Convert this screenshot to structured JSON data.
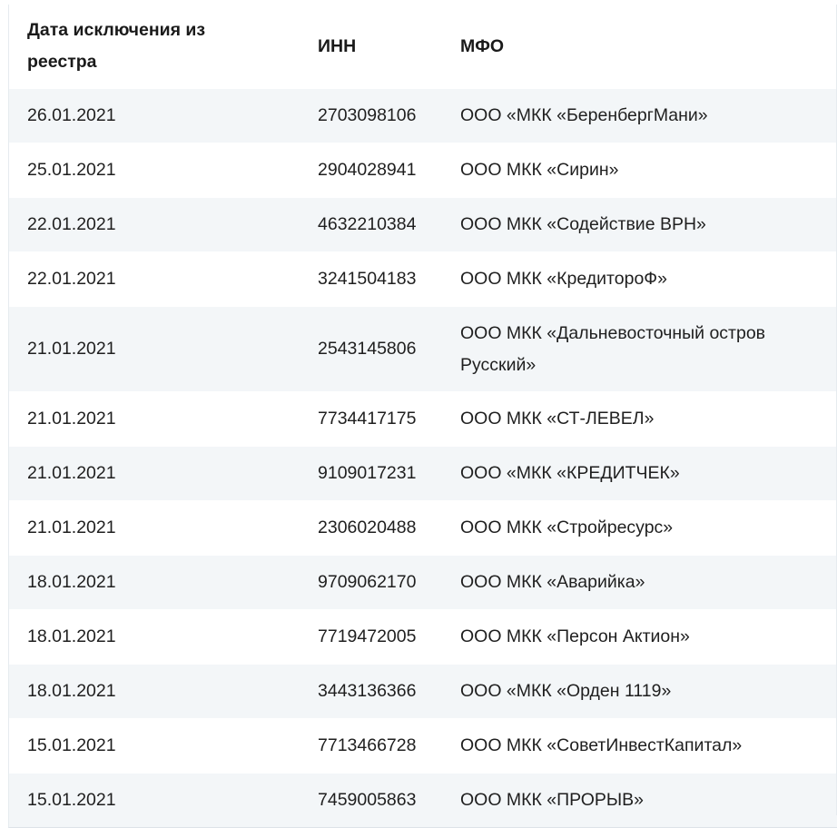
{
  "table": {
    "headers": {
      "date": "Дата исключения из реестра",
      "inn": "ИНН",
      "mfo": "МФО"
    },
    "rows": [
      {
        "date": "26.01.2021",
        "inn": "2703098106",
        "mfo": "ООО «МКК «БеренбергМани»"
      },
      {
        "date": "25.01.2021",
        "inn": "2904028941",
        "mfo": "ООО МКК «Сирин»"
      },
      {
        "date": "22.01.2021",
        "inn": "4632210384",
        "mfo": "ООО МКК «Содействие ВРН»"
      },
      {
        "date": "22.01.2021",
        "inn": "3241504183",
        "mfo": "ООО МКК «КредитороФ»"
      },
      {
        "date": "21.01.2021",
        "inn": "2543145806",
        "mfo": "ООО МКК «Дальневосточный остров Русский»"
      },
      {
        "date": "21.01.2021",
        "inn": "7734417175",
        "mfo": "ООО МКК «СТ-ЛЕВЕЛ»"
      },
      {
        "date": "21.01.2021",
        "inn": "9109017231",
        "mfo": "ООО «МКК «КРЕДИТЧЕК»"
      },
      {
        "date": "21.01.2021",
        "inn": "2306020488",
        "mfo": "ООО МКК «Стройресурс»"
      },
      {
        "date": "18.01.2021",
        "inn": "9709062170",
        "mfo": "ООО МКК «Аварийка»"
      },
      {
        "date": "18.01.2021",
        "inn": "7719472005",
        "mfo": "ООО МКК «Персон Актион»"
      },
      {
        "date": "18.01.2021",
        "inn": "3443136366",
        "mfo": "ООО «МКК «Орден 1119»"
      },
      {
        "date": "15.01.2021",
        "inn": "7713466728",
        "mfo": "ООО МКК «СоветИнвестКапитал»"
      },
      {
        "date": "15.01.2021",
        "inn": "7459005863",
        "mfo": "ООО МКК «ПРОРЫВ»"
      }
    ]
  }
}
